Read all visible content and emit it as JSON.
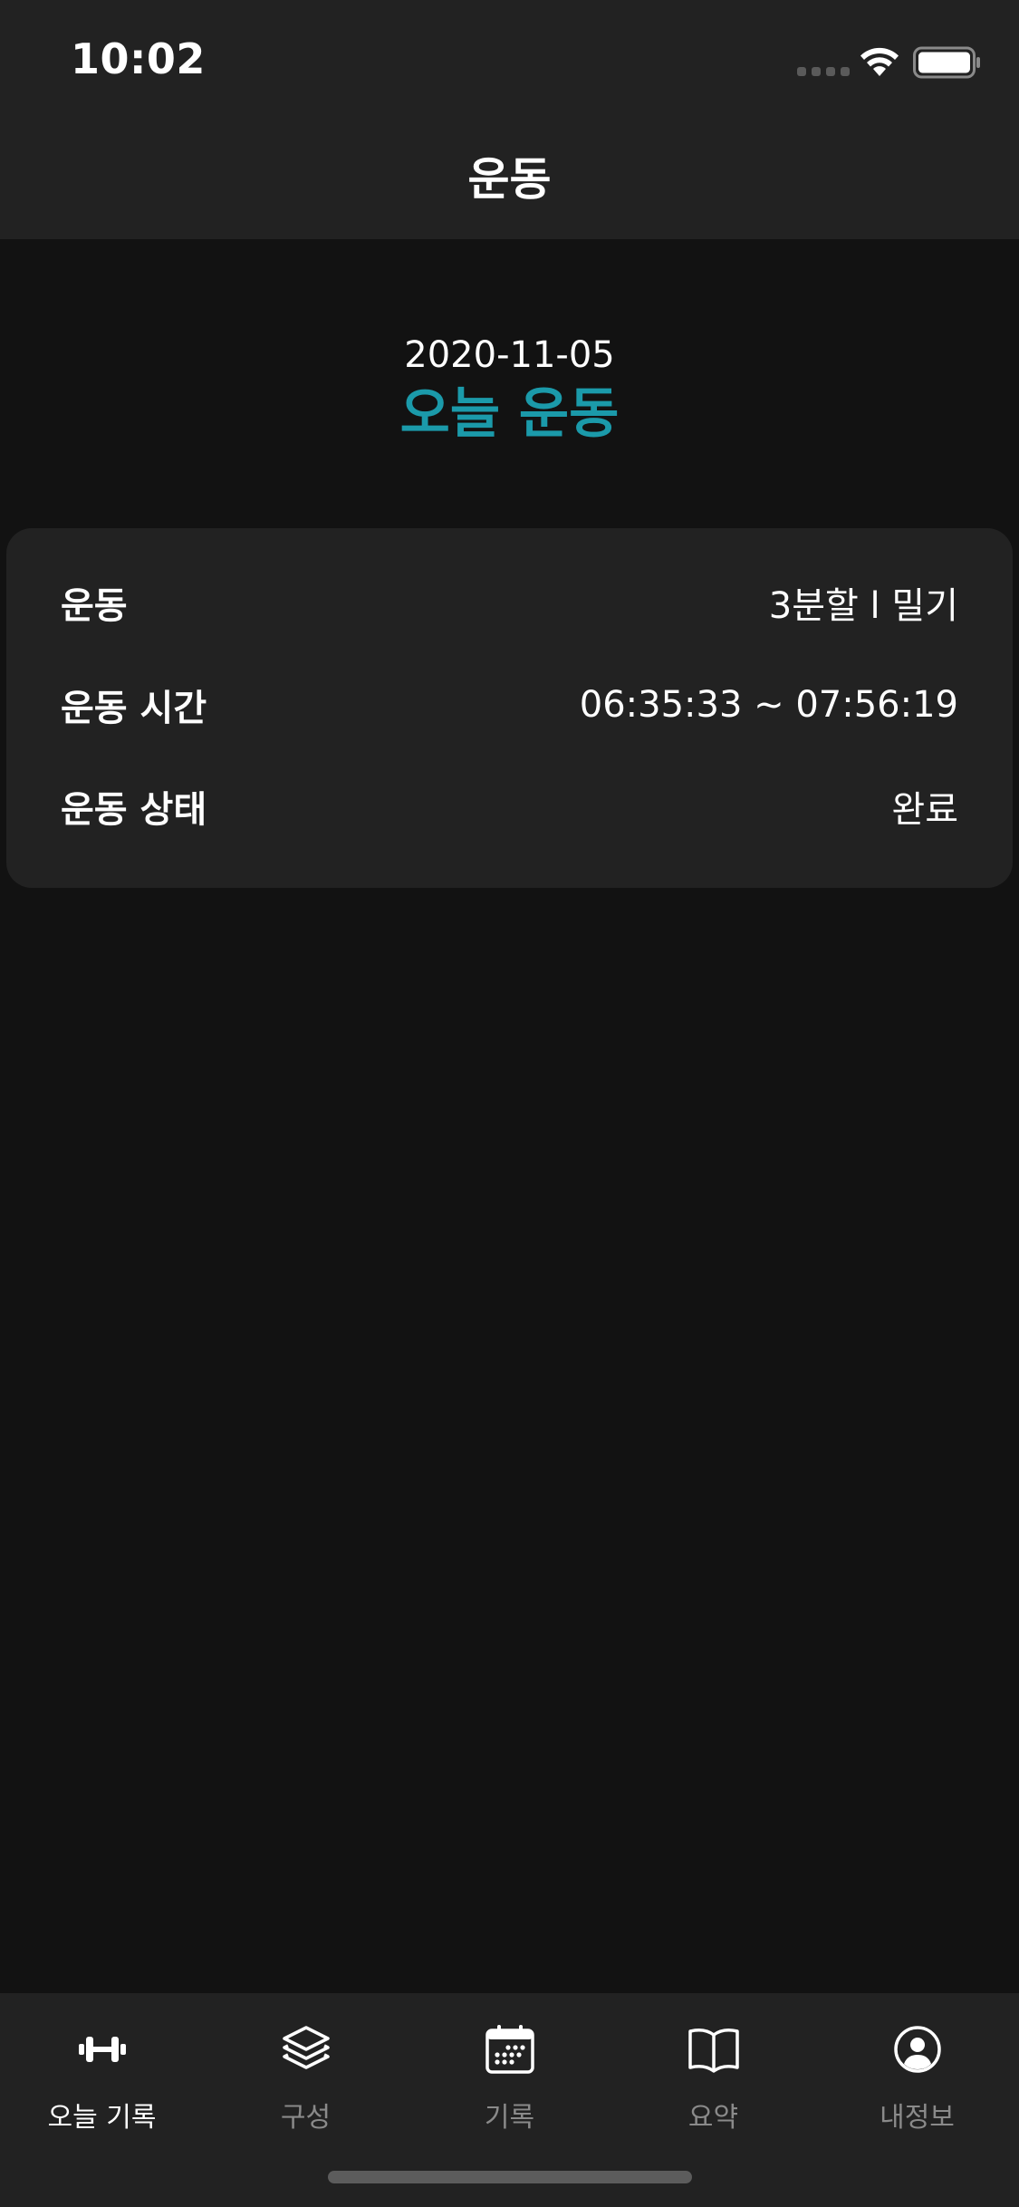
{
  "status_bar": {
    "time": "10:02"
  },
  "nav": {
    "title": "운동"
  },
  "header": {
    "date": "2020-11-05",
    "title": "오늘 운동",
    "accent_color": "#1b9aaa"
  },
  "workout_info": {
    "rows": [
      {
        "label": "운동",
        "value": "3분할 l 밀기"
      },
      {
        "label": "운동 시간",
        "value": "06:35:33 ~ 07:56:19"
      },
      {
        "label": "운동 상태",
        "value": "완료"
      }
    ]
  },
  "tab_bar": {
    "items": [
      {
        "label": "오늘 기록",
        "icon": "dumbbell-icon",
        "active": true
      },
      {
        "label": "구성",
        "icon": "layers-icon",
        "active": false
      },
      {
        "label": "기록",
        "icon": "calendar-icon",
        "active": false
      },
      {
        "label": "요약",
        "icon": "book-icon",
        "active": false
      },
      {
        "label": "내정보",
        "icon": "user-circle-icon",
        "active": false
      }
    ],
    "active_color": "#ffffff",
    "inactive_color": "#8a8a8a"
  }
}
